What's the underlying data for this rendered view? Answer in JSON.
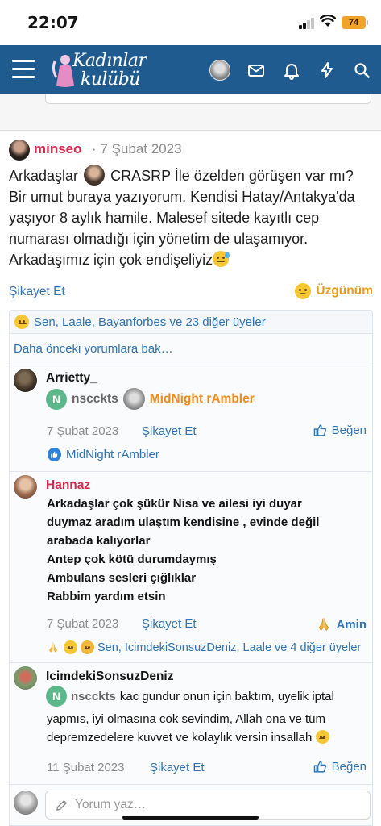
{
  "status_bar": {
    "time": "22:07",
    "battery": "74"
  },
  "nav": {
    "logo_line1": "Kadınlar",
    "logo_line2": "kulübü",
    "icons": [
      "menu-icon",
      "avatar",
      "mail-icon",
      "bell-icon",
      "bolt-icon",
      "search-icon"
    ]
  },
  "post": {
    "author": "minseo",
    "date_sep": "·",
    "date": "7 Şubat 2023",
    "body_part1": "Arkadaşlar",
    "mention": "CRASRP",
    "body_part2": "İle özelden görüşen var mı? Bir umut buraya yazıyorum. Kendisi Hatay/Antakya'da yaşıyor 8 aylık hamile. Malesef sitede kayıtlı cep numarası olmadığı için yönetim de ulaşamıyor. Arkadaşımız için çok endişeliyiz",
    "report_label": "Şikayet Et",
    "reaction_label": "Üzgünüm",
    "reactions_summary": "Sen, Laale, Bayanforbes ve 23 diğer üyeler",
    "more_comments": "Daha önceki yorumlara bak…"
  },
  "comments": [
    {
      "author": "Arrietty_",
      "author_color": "#d42b4f",
      "mention1": "nscckts",
      "mention2": "MidNight rAmbler",
      "date": "7 Şubat 2023",
      "report_label": "Şikayet Et",
      "like_label": "Beğen",
      "reactions": "MidNight rAmbler"
    },
    {
      "author": "Hannaz",
      "author_color": "#d42b4f",
      "lines": [
        "Arkadaşlar çok şükür Nisa ve ailesi iyi duyar",
        "duymaz aradım ulaştım kendisine , evinde değil",
        "arabada kalıyorlar",
        "Antep çok kötü durumdaymış",
        "Ambulans sesleri çığlıklar",
        "Rabbim yardım etsin"
      ],
      "date": "7 Şubat 2023",
      "report_label": "Şikayet Et",
      "reaction_label": "Amin",
      "reactions": "Sen, IcimdekiSonsuzDeniz, Laale ve 4 diğer üyeler"
    },
    {
      "author": "IcimdekiSonsuzDeniz",
      "author_color": "#141414",
      "mention": "nscckts",
      "text_after_mention": "kac gundur onun için baktım, uyelik iptal",
      "text_line2": "yapmıs, iyi olmasına cok sevindim, Allah ona ve tüm",
      "text_line3": "depremzedelere kuvvet ve kolaylık versin insallah",
      "date": "11 Şubat 2023",
      "report_label": "Şikayet Et",
      "like_label": "Beğen"
    }
  ],
  "reply": {
    "placeholder": "Yorum yaz…"
  },
  "colors": {
    "nav_bg": "#1f5b8e",
    "link": "#2f73b8",
    "username": "#d42b4f",
    "sad_reaction": "#e89b17"
  }
}
